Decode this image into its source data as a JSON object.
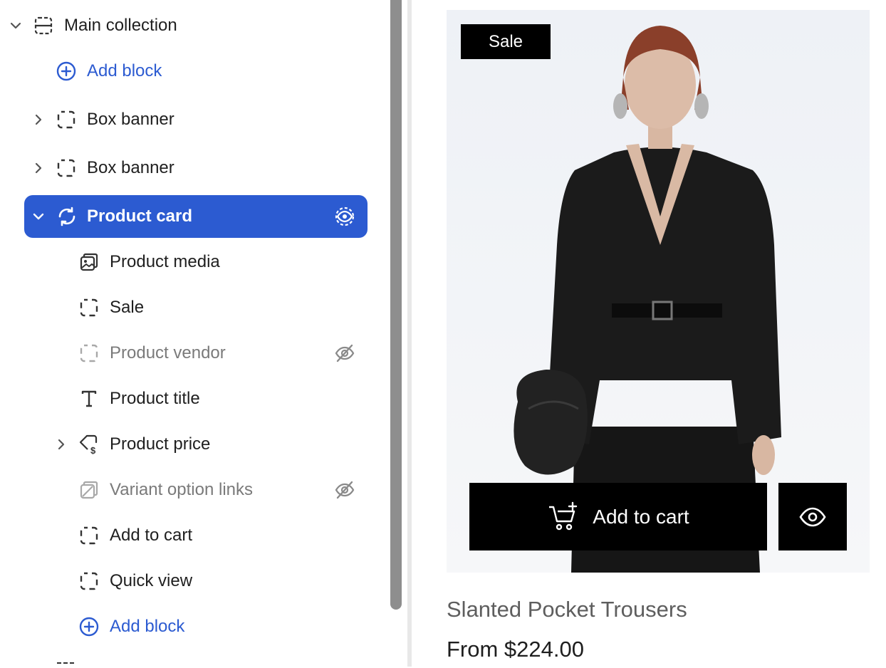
{
  "sidebar": {
    "main_collection": "Main collection",
    "add_block_top": "Add block",
    "box_banner_1": "Box banner",
    "box_banner_2": "Box banner",
    "product_card": "Product card",
    "children": {
      "product_media": "Product media",
      "sale": "Sale",
      "product_vendor": "Product vendor",
      "product_title": "Product title",
      "product_price": "Product price",
      "variant_option_links": "Variant option links",
      "add_to_cart": "Add to cart",
      "quick_view": "Quick view",
      "add_block": "Add block"
    },
    "hidden_items": [
      "Product vendor",
      "Variant option links"
    ],
    "accent_color": "#2c5bd1"
  },
  "preview": {
    "sale_badge": "Sale",
    "add_to_cart_label": "Add to cart",
    "product_title": "Slanted Pocket Trousers",
    "product_price": "From $224.00"
  },
  "icons": [
    "chevron-down-icon",
    "section-icon",
    "plus-circle-icon",
    "chevron-right-icon",
    "block-icon",
    "refresh-icon",
    "eye-icon",
    "image-stack-icon",
    "eye-off-icon",
    "text-icon",
    "price-tag-icon",
    "variant-icon",
    "cart-plus-icon"
  ]
}
